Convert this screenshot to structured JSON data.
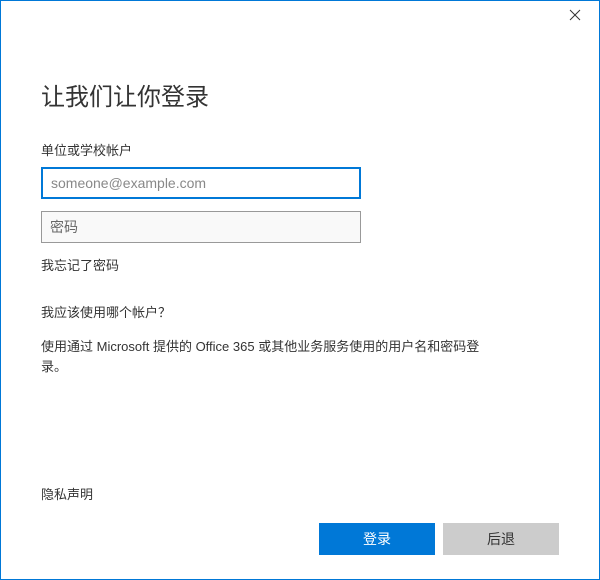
{
  "title": "让我们让你登录",
  "fields": {
    "account_label": "单位或学校帐户",
    "email_placeholder": "someone@example.com",
    "email_value": "",
    "password_placeholder": "密码",
    "password_value": ""
  },
  "links": {
    "forgot_password": "我忘记了密码",
    "which_account": "我应该使用哪个帐户？",
    "privacy": "隐私声明"
  },
  "description": "使用通过 Microsoft 提供的 Office 365 或其他业务服务使用的用户名和密码登录。",
  "buttons": {
    "signin": "登录",
    "back": "后退"
  }
}
